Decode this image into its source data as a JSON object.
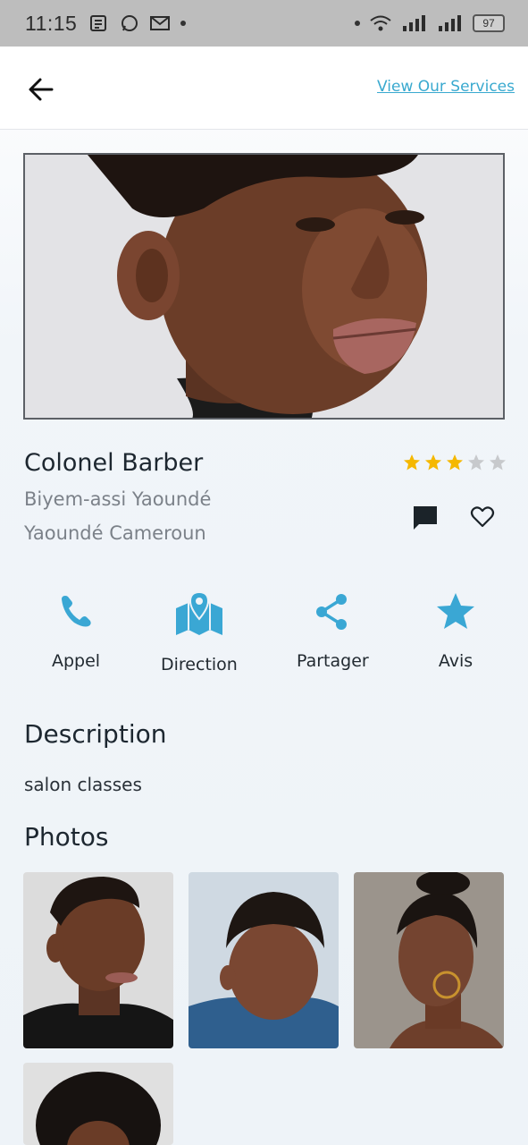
{
  "status_bar": {
    "time": "11:15",
    "battery": "97"
  },
  "header": {
    "back_icon": "arrow-left-icon",
    "services_link": "View Our Services"
  },
  "salon": {
    "name": "Colonel Barber",
    "rating": 3,
    "rating_max": 5,
    "address_line1": "Biyem-assi Yaoundé",
    "address_line2": "Yaoundé Cameroun"
  },
  "actions": [
    {
      "label": "Appel",
      "icon": "phone-icon"
    },
    {
      "label": "Direction",
      "icon": "map-icon"
    },
    {
      "label": "Partager",
      "icon": "share-icon"
    },
    {
      "label": "Avis",
      "icon": "star-icon"
    }
  ],
  "description": {
    "title": "Description",
    "text": "salon classes"
  },
  "photos": {
    "title": "Photos"
  },
  "colors": {
    "accent": "#39a9cf",
    "star_filled": "#f5b800",
    "star_empty": "#c7c9cc"
  }
}
